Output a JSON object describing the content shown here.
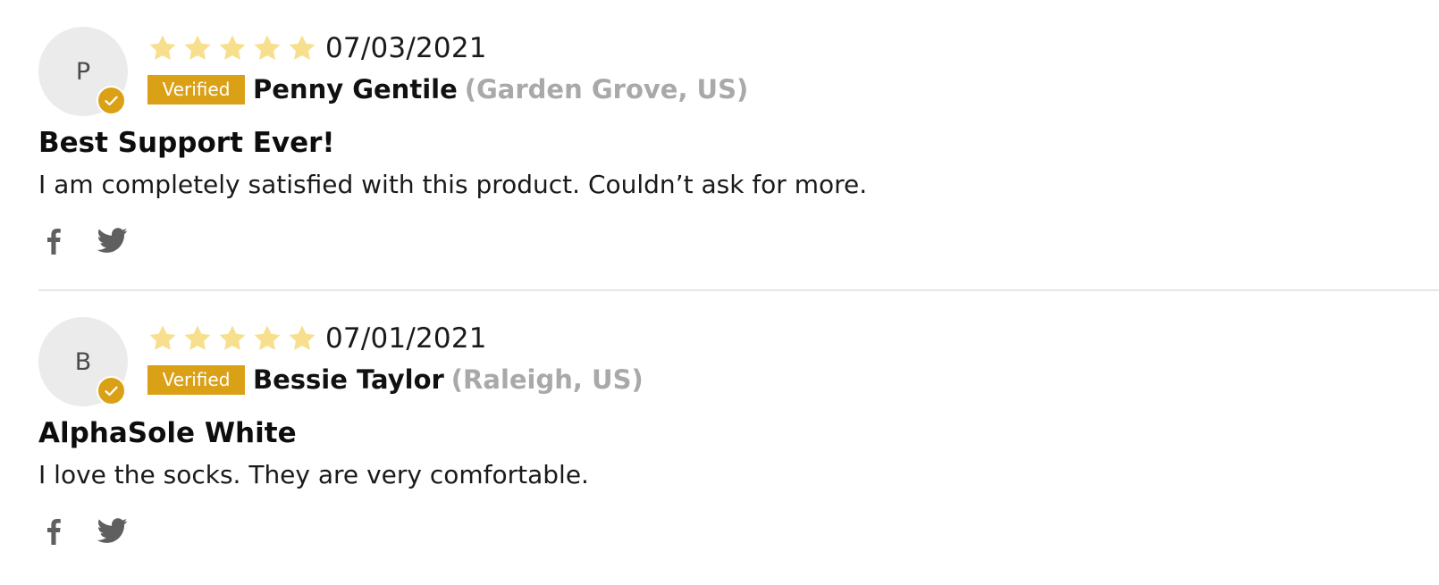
{
  "colors": {
    "accent": "#dba116",
    "star": "#f7df8e",
    "location": "#a9a9a9",
    "divider": "#e6e6e6",
    "avatar_bg": "#ebebeb",
    "share_icon": "#5f5f5f"
  },
  "reviews": [
    {
      "avatar_initial": "P",
      "rating": 5,
      "date": "07/03/2021",
      "verified_label": "Verified",
      "author": "Penny Gentile",
      "location": "(Garden Grove, US)",
      "title": "Best Support Ever!",
      "body": "I am completely satisfied with this product. Couldn’t ask for more.",
      "share_icons": [
        "facebook-icon",
        "twitter-icon"
      ]
    },
    {
      "avatar_initial": "B",
      "rating": 5,
      "date": "07/01/2021",
      "verified_label": "Verified",
      "author": "Bessie Taylor",
      "location": "(Raleigh, US)",
      "title": "AlphaSole White",
      "body": "I love the socks. They are very comfortable.",
      "share_icons": [
        "facebook-icon",
        "twitter-icon"
      ]
    }
  ]
}
